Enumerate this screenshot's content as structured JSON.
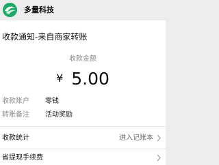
{
  "header": {
    "brand": "多量科技",
    "logo_icon": "brand-logo-icon",
    "accent": "#1faa6a"
  },
  "notice": {
    "title": "收款通知-来自商家转账",
    "amount_label": "收款金额",
    "currency": "¥",
    "amount": "5.00"
  },
  "details": [
    {
      "label": "收款账户",
      "value": "零钱"
    },
    {
      "label": "转账备注",
      "value": "活动奖励"
    }
  ],
  "links": [
    {
      "label": "收款统计",
      "action": "进入记账本",
      "icon": "chevron-right-icon"
    },
    {
      "label": "省提现手续费",
      "action": "",
      "icon": "chevron-right-icon"
    }
  ]
}
